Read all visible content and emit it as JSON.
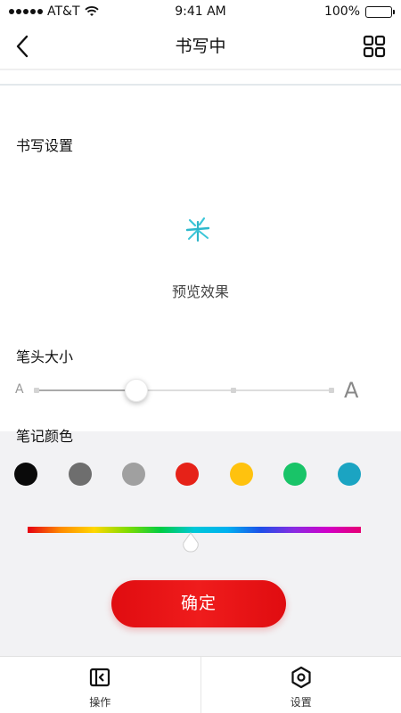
{
  "status_bar": {
    "carrier": "AT&T",
    "time": "9:41 AM",
    "battery": "100%"
  },
  "nav": {
    "title": "书写中",
    "back_icon": "chevron-left-icon",
    "menu_icon": "grid-icon"
  },
  "writing_settings": {
    "title": "书写设置",
    "preview_label": "预览效果"
  },
  "pen_size": {
    "title": "笔头大小",
    "small_label": "A",
    "large_label": "A",
    "value": 0.34
  },
  "pen_color": {
    "title": "笔记颜色",
    "swatches": [
      {
        "name": "black",
        "color": "#0a0a0a"
      },
      {
        "name": "dark-gray",
        "color": "#6e6e6e"
      },
      {
        "name": "light-gray",
        "color": "#a0a0a0"
      },
      {
        "name": "red",
        "color": "#e62218"
      },
      {
        "name": "yellow",
        "color": "#ffc20e"
      },
      {
        "name": "green",
        "color": "#19c468"
      },
      {
        "name": "cyan",
        "color": "#1ba4c2"
      }
    ],
    "spectrum_position": 0.49
  },
  "confirm_button": "确定",
  "tab_bar": {
    "items": [
      {
        "label": "操作",
        "icon": "operation-icon"
      },
      {
        "label": "设置",
        "icon": "settings-hexagon-icon"
      }
    ]
  },
  "colors": {
    "accent": "#e00c10",
    "background": "#f2f2f4"
  }
}
